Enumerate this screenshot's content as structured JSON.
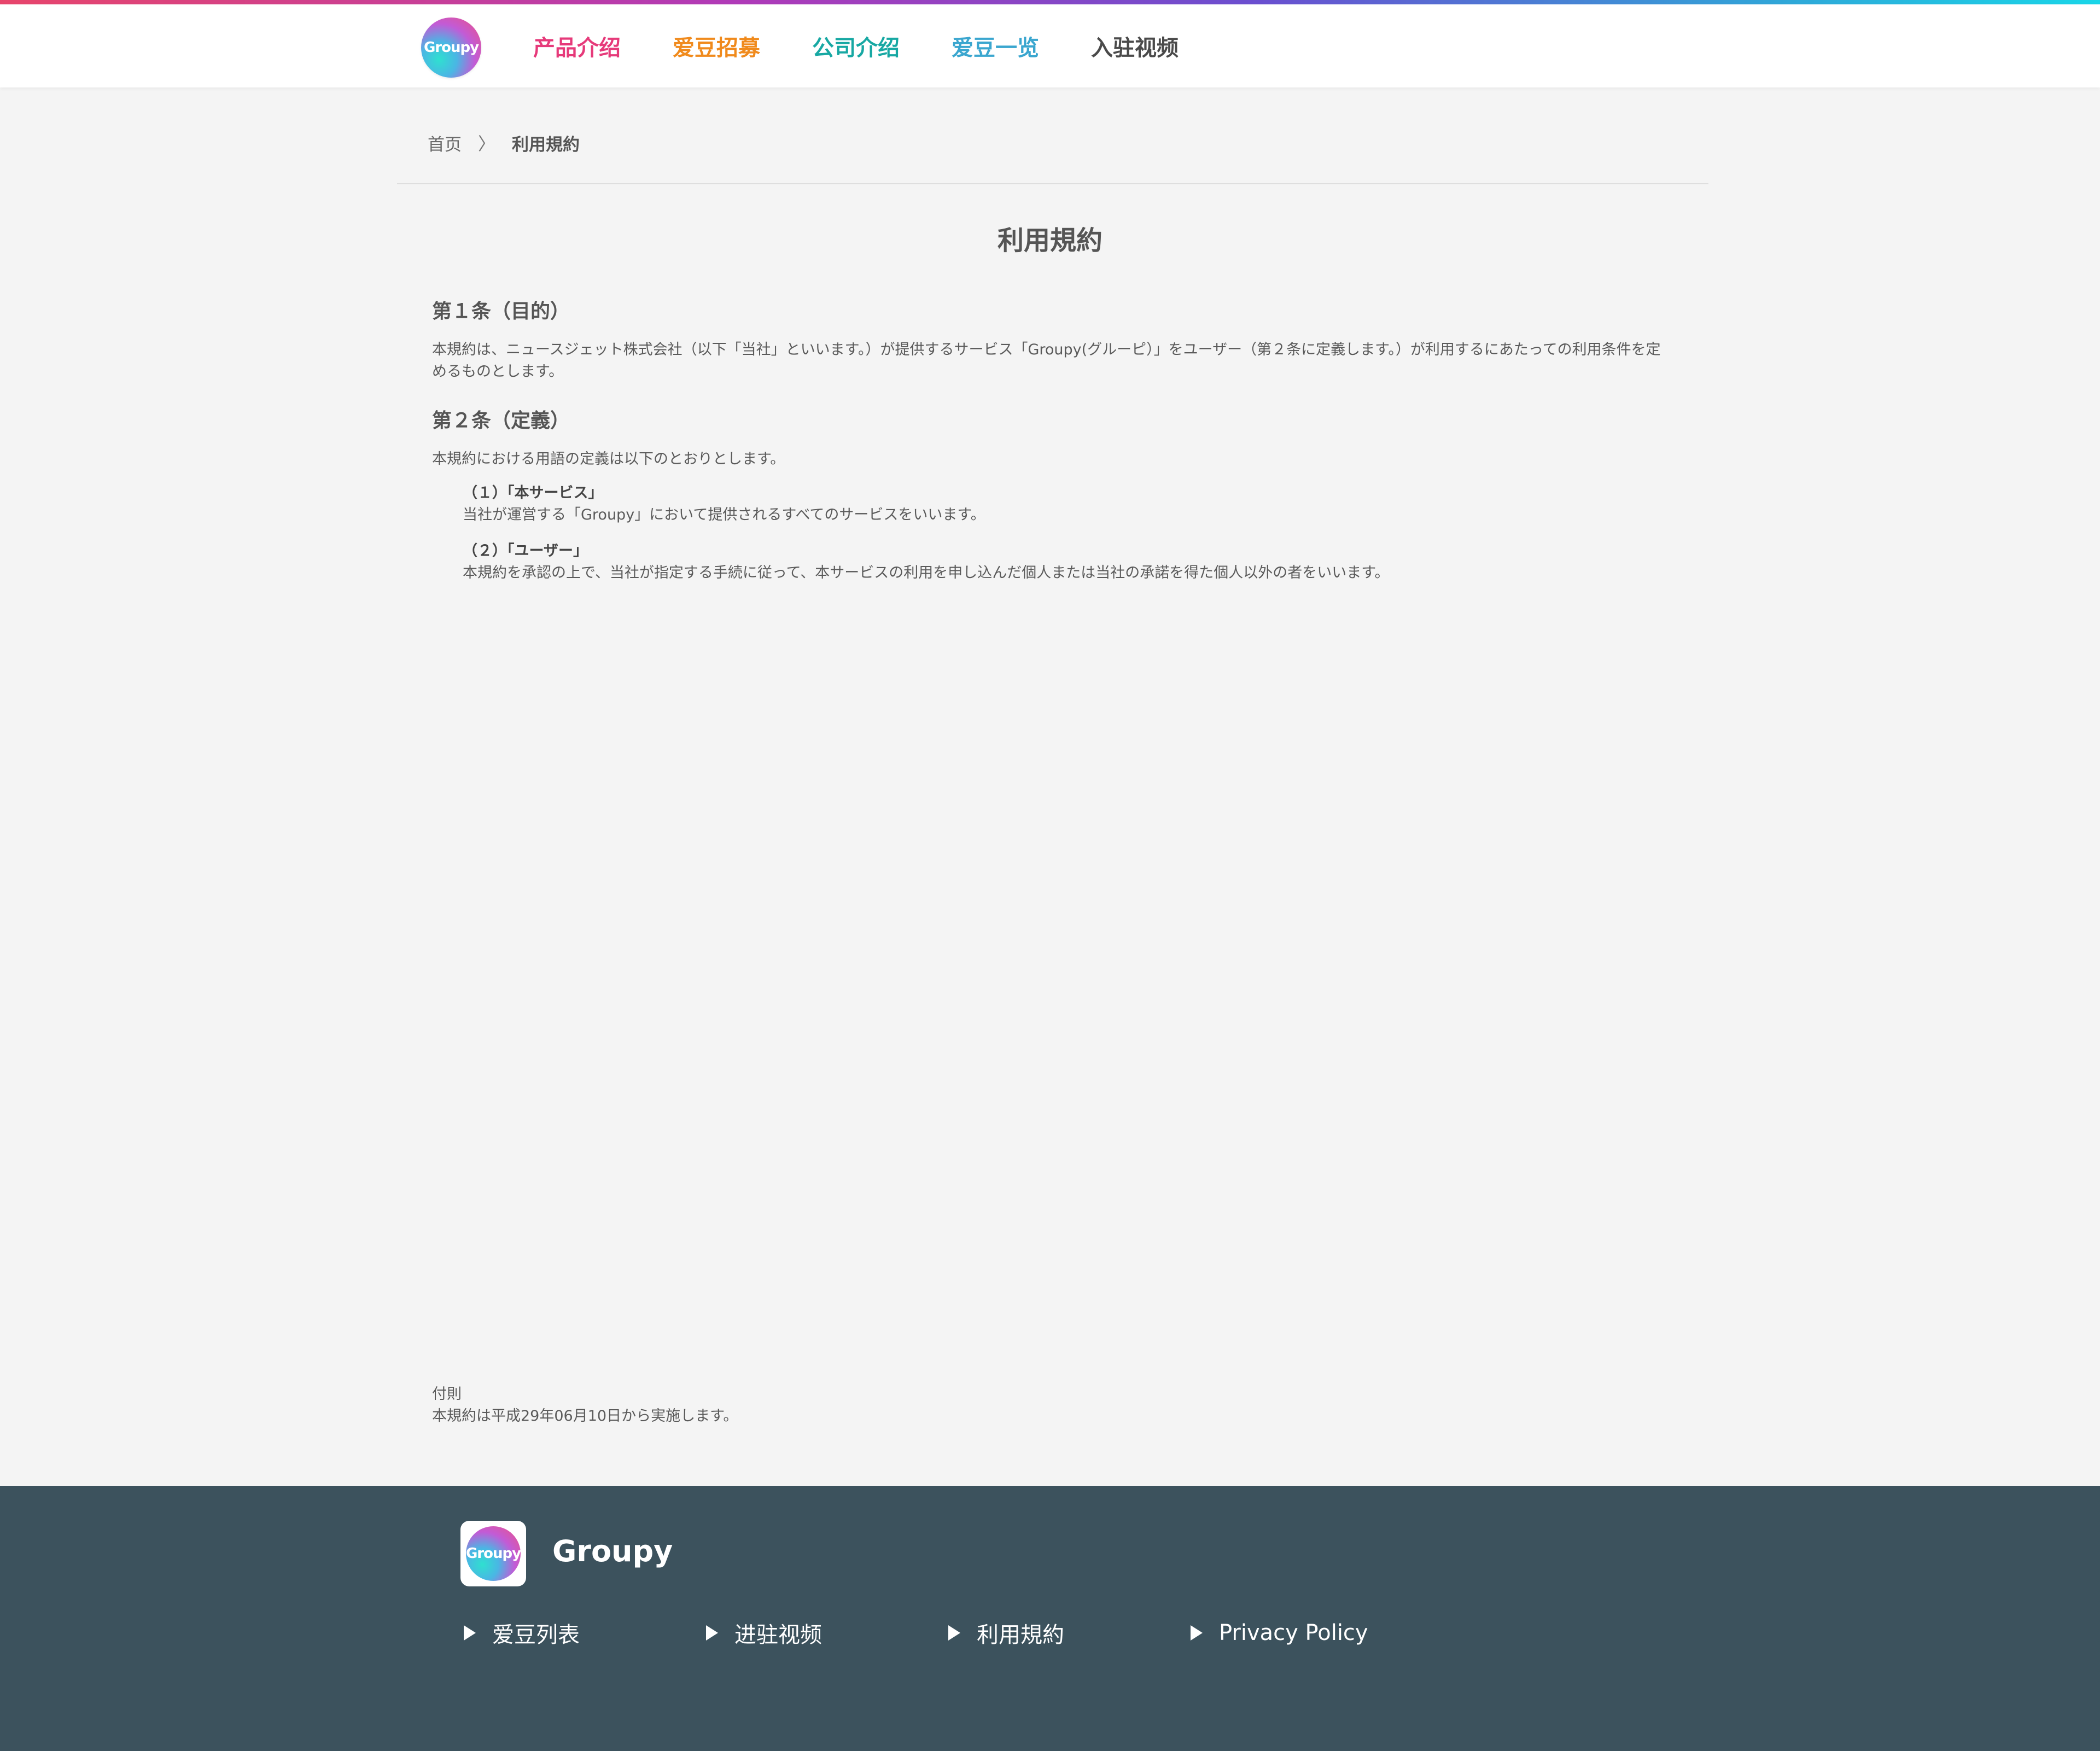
{
  "header": {
    "logo_text": "Groupy",
    "nav": [
      {
        "label": "产品介绍",
        "color": "#e63a7a"
      },
      {
        "label": "爱豆招募",
        "color": "#f08a1c"
      },
      {
        "label": "公司介绍",
        "color": "#17a8a3"
      },
      {
        "label": "爱豆一览",
        "color": "#3aa6cf"
      },
      {
        "label": "入驻视频",
        "color": "#4a4a4a"
      }
    ]
  },
  "breadcrumb": {
    "home": "首页",
    "separator": "〉",
    "current": "利用規約"
  },
  "page": {
    "title": "利用規約",
    "article1": {
      "heading": "第１条（目的）",
      "text": "本規約は、ニュースジェット株式会社（以下「当社」といいます。）が提供するサービス「Groupy(グルーピ）」をユーザー（第２条に定義します。）が利用するにあたっての利用条件を定めるものとします。"
    },
    "article2": {
      "heading": "第２条（定義）",
      "intro": "本規約における用語の定義は以下のとおりとします。",
      "items": [
        {
          "term": "（１）「本サービス」",
          "desc": "当社が運営する「Groupy」において提供されるすべてのサービスをいいます。"
        },
        {
          "term": "（２）「ユーザー」",
          "desc": "本規約を承認の上で、当社が指定する手続に従って、本サービスの利用を申し込んだ個人または当社の承諾を得た個人以外の者をいいます。"
        }
      ]
    },
    "appendix": {
      "label": "付則",
      "text": "本規約は平成29年06月10日から実施します。"
    }
  },
  "footer": {
    "logo_text": "Groupy",
    "brand": "Groupy",
    "links": [
      "爱豆列表",
      "进驻视频",
      "利用規約",
      "Privacy Policy"
    ]
  }
}
